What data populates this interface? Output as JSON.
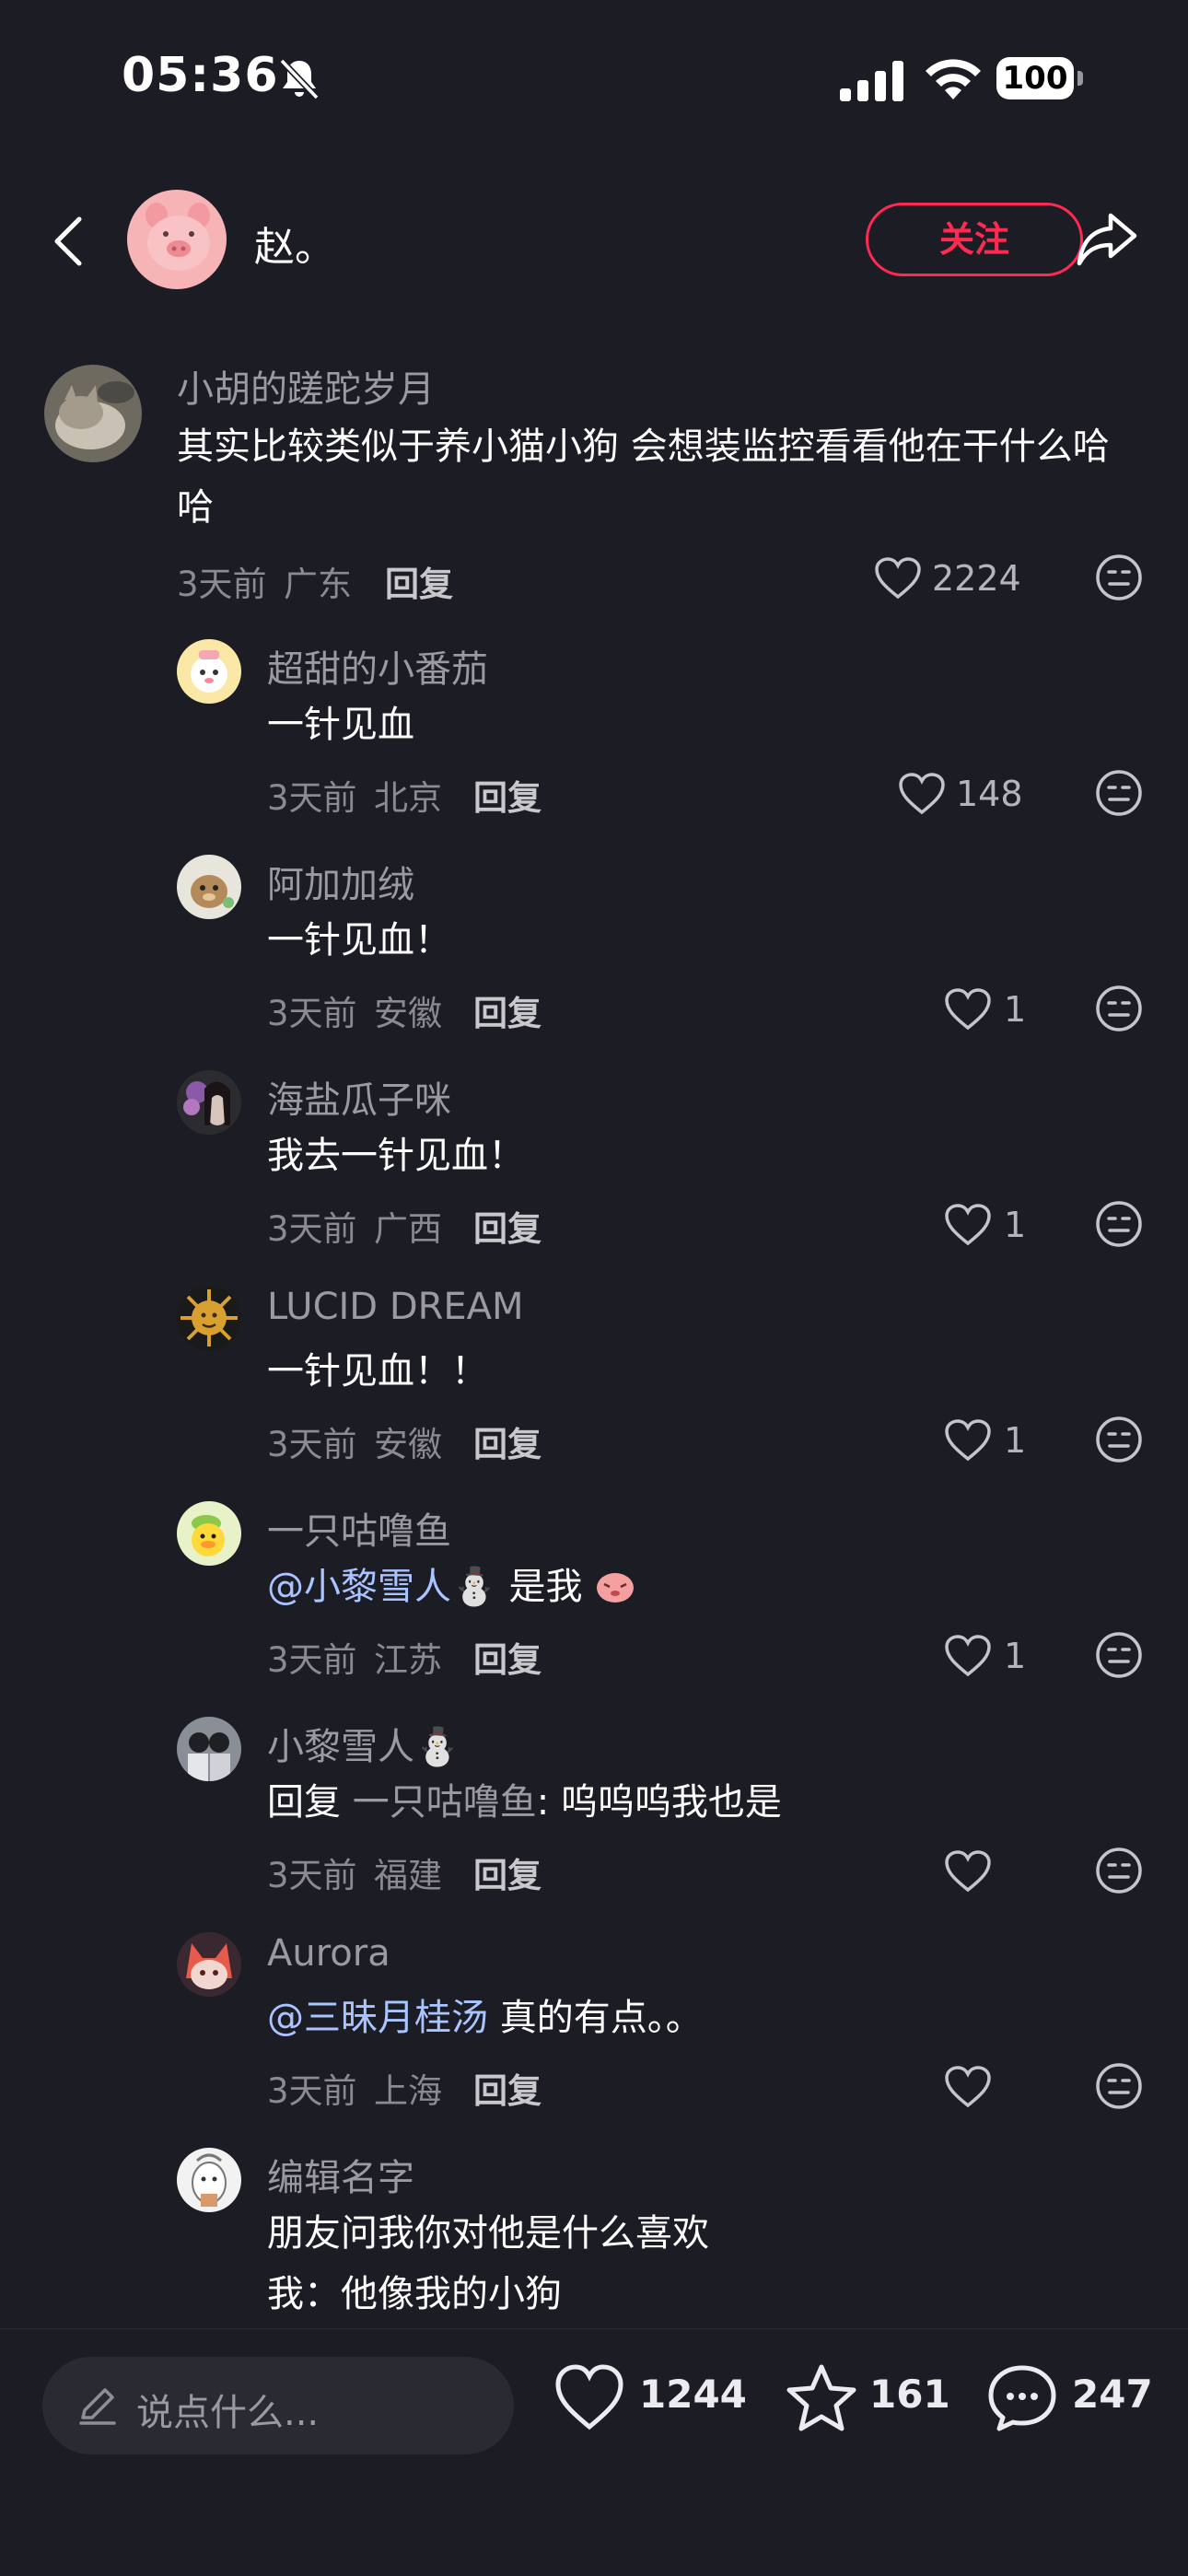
{
  "status_bar": {
    "time": "05:36",
    "battery": "100",
    "icons": [
      "bell-slash-icon",
      "signal-icon",
      "wifi-icon",
      "battery-icon"
    ]
  },
  "header": {
    "author_name": "赵。",
    "follow_label": "关注",
    "icons": [
      "back-icon",
      "share-icon"
    ]
  },
  "comments": [
    {
      "username": "小胡的蹉跎岁月",
      "text_lines": [
        "其实比较类似于养小猫小狗 会想装监控看看他在干什么哈",
        "哈"
      ],
      "time": "3天前",
      "location": "广东",
      "reply_label": "回复",
      "likes": "2224"
    },
    {
      "username": "超甜的小番茄",
      "text_lines": [
        "一针见血"
      ],
      "time": "3天前",
      "location": "北京",
      "reply_label": "回复",
      "likes": "148"
    },
    {
      "username": "阿加加绒",
      "text_lines": [
        "一针见血！"
      ],
      "time": "3天前",
      "location": "安徽",
      "reply_label": "回复",
      "likes": "1"
    },
    {
      "username": "海盐瓜子咪",
      "text_lines": [
        "我去一针见血！"
      ],
      "time": "3天前",
      "location": "广西",
      "reply_label": "回复",
      "likes": "1"
    },
    {
      "username": "LUCID DREAM",
      "text_lines": [
        "一针见血！！"
      ],
      "time": "3天前",
      "location": "安徽",
      "reply_label": "回复",
      "likes": "1"
    },
    {
      "username": "一只咕噜鱼",
      "mention": "@小黎雪人⛄",
      "text_after": "是我",
      "time": "3天前",
      "location": "江苏",
      "reply_label": "回复",
      "likes": "1"
    },
    {
      "username": "小黎雪人⛄",
      "reply_prefix": "回复",
      "reply_to": "一只咕噜鱼",
      "text_after": ": 呜呜呜我也是",
      "time": "3天前",
      "location": "福建",
      "reply_label": "回复",
      "likes": ""
    },
    {
      "username": "Aurora",
      "mention": "@三昧月桂汤",
      "text_after": "真的有点。。",
      "time": "3天前",
      "location": "上海",
      "reply_label": "回复",
      "likes": ""
    },
    {
      "username": "编辑名字",
      "text_lines": [
        "朋友问我你对他是什么喜欢",
        "我：他像我的小狗"
      ]
    }
  ],
  "bottom_bar": {
    "input_placeholder": "说点什么...",
    "likes": "1244",
    "favorites": "161",
    "comments": "247"
  },
  "colors": {
    "background": "#1c1c24",
    "accent": "#ff2a51",
    "mention": "#a9c4ff"
  }
}
